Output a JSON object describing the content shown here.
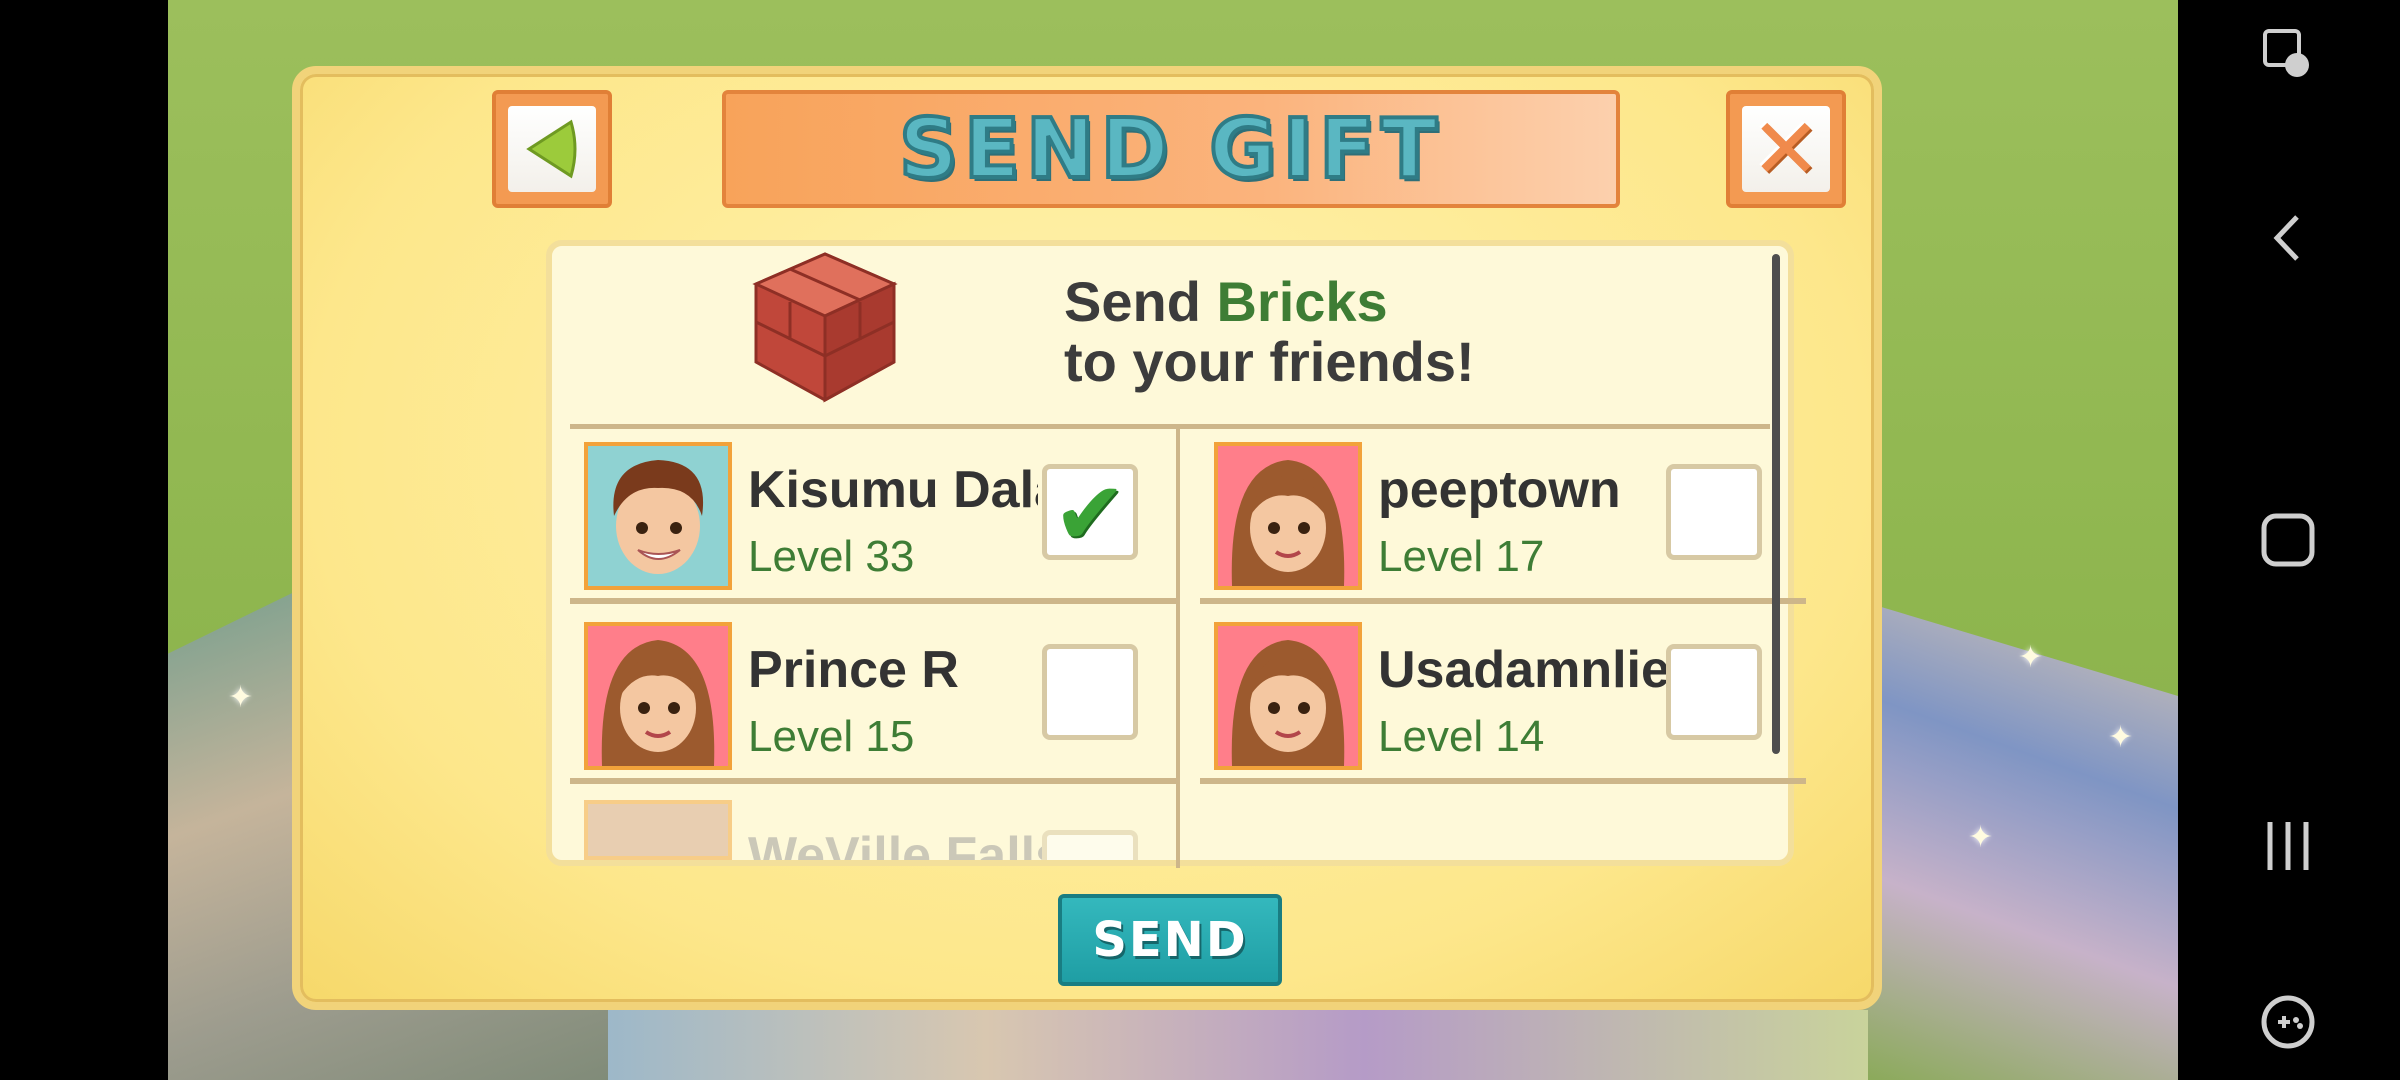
{
  "dialog": {
    "title": "SEND GIFT",
    "heading_prefix": "Send ",
    "heading_item": "Bricks",
    "heading_suffix": "to your friends!",
    "send_label": "SEND"
  },
  "friends": [
    {
      "name": "Kisumu Dala",
      "level": "Level 33",
      "checked": true,
      "avatar": "boy"
    },
    {
      "name": "peeptown",
      "level": "Level 17",
      "checked": false,
      "avatar": "girl"
    },
    {
      "name": "Prince R",
      "level": "Level 15",
      "checked": false,
      "avatar": "girl"
    },
    {
      "name": "Usadamnlie",
      "level": "Level 14",
      "checked": false,
      "avatar": "girl"
    },
    {
      "name": "WeVille Falls",
      "level": "",
      "checked": false,
      "avatar": "girl"
    }
  ],
  "icons": {
    "back": "back-arrow-icon",
    "close": "close-x-icon",
    "gift": "bricks-icon",
    "check": "checkmark-icon"
  },
  "colors": {
    "accent_green": "#3e7d35",
    "title_teal": "#5ab7c2",
    "send_button": "#1f9ea4",
    "frame_orange": "#f39a52"
  }
}
